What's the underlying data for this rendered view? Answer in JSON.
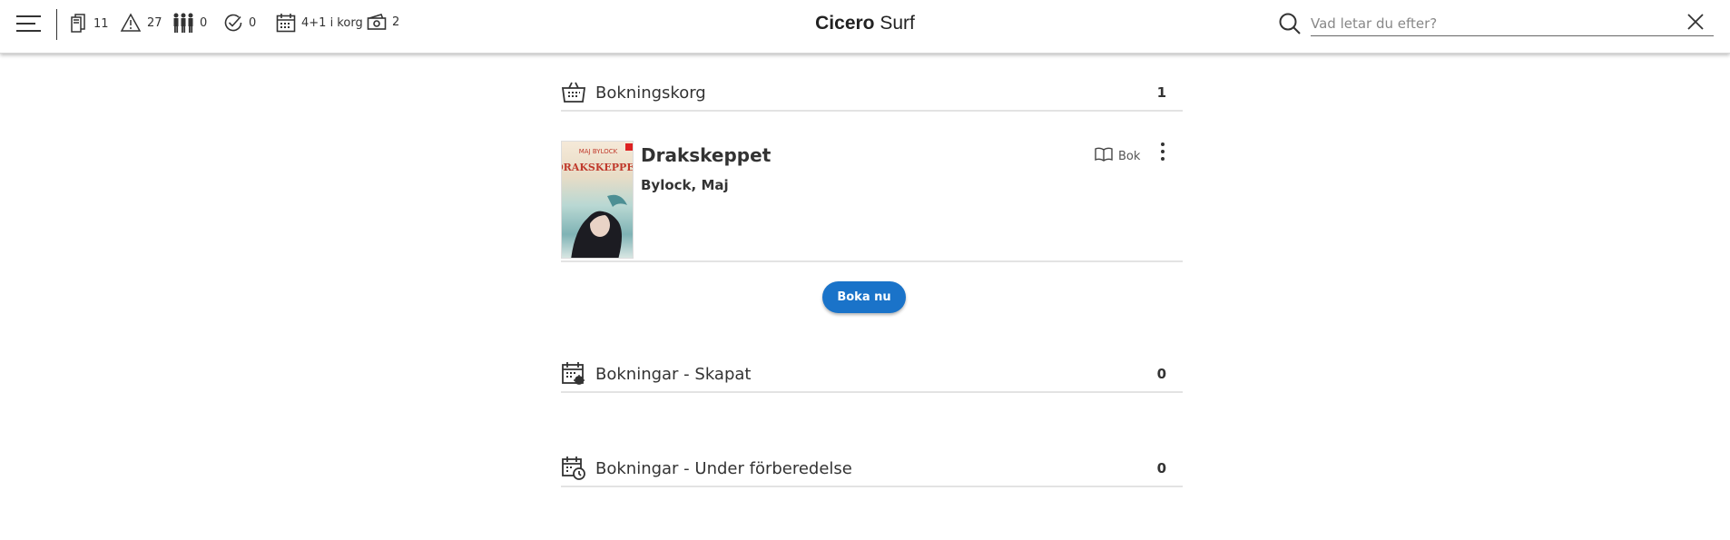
{
  "header": {
    "title_bold": "Cicero",
    "title_rest": " Surf",
    "status": [
      {
        "icon": "loans-icon",
        "value": "11"
      },
      {
        "icon": "warning-icon",
        "value": "27"
      },
      {
        "icon": "group-icon",
        "value": "0"
      },
      {
        "icon": "check-icon",
        "value": "0"
      },
      {
        "icon": "calendar-icon",
        "value": "4+1 i korg"
      },
      {
        "icon": "cash-icon",
        "value": "2"
      }
    ]
  },
  "search": {
    "placeholder": "Vad letar du efter?",
    "value": ""
  },
  "sections": {
    "basket": {
      "label": "Bokningskorg",
      "count": "1"
    },
    "created": {
      "label": "Bokningar - Skapat",
      "count": "0"
    },
    "preparing": {
      "label": "Bokningar - Under förberedelse",
      "count": "0"
    }
  },
  "book": {
    "title": "Drakskeppet",
    "author": "Bylock, Maj",
    "type": "Bok",
    "cover_author": "MAJ BYLOCK",
    "cover_title": "DRAKSKEPPET"
  },
  "actions": {
    "book_now": "Boka nu"
  },
  "colors": {
    "primary_button": "#1a73c9",
    "cover_title": "#c0392b"
  }
}
